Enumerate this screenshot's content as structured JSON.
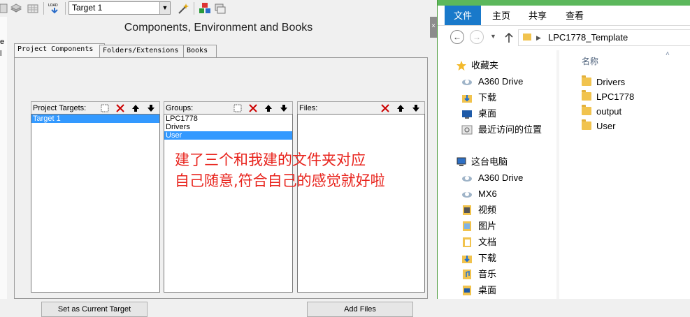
{
  "keil": {
    "toolbar": {
      "load_label": "LOAD",
      "target_value": "Target 1"
    },
    "left_strip_chars": [
      "e",
      "l"
    ],
    "dialog": {
      "title": "Components, Environment and Books",
      "close_glyph": "×",
      "tabs": [
        "Project Components",
        "Folders/Extensions",
        "Books"
      ],
      "columns": {
        "targets_label": "Project Targets:",
        "groups_label": "Groups:",
        "files_label": "Files:"
      },
      "targets": [
        "Target 1"
      ],
      "groups": [
        "LPC1778",
        "Drivers",
        "User"
      ],
      "selected_target": "Target 1",
      "selected_group": "User",
      "buttons": {
        "set_current": "Set as Current Target",
        "add_files": "Add Files"
      }
    },
    "annotation": {
      "line1": "建了三个和我建的文件夹对应",
      "line2": "自己随意,符合自己的感觉就好啦"
    }
  },
  "explorer": {
    "ribbon": {
      "file": "文件",
      "home": "主页",
      "share": "共享",
      "view": "查看"
    },
    "address": {
      "path": "LPC1778_Template"
    },
    "nav": {
      "favorites": "收藏夹",
      "fav_items": [
        "A360 Drive",
        "下载",
        "桌面",
        "最近访问的位置"
      ],
      "this_pc": "这台电脑",
      "pc_items": [
        "A360 Drive",
        "MX6",
        "视频",
        "图片",
        "文档",
        "下载",
        "音乐",
        "桌面"
      ]
    },
    "content": {
      "column_name": "名称",
      "folders": [
        "Drivers",
        "LPC1778",
        "output",
        "User"
      ]
    }
  }
}
